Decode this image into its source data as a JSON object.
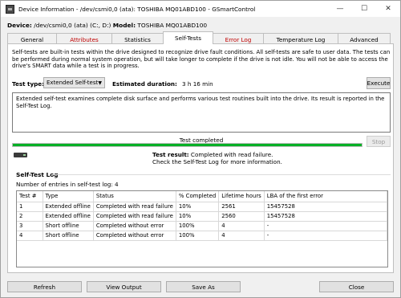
{
  "window": {
    "title": "Device Information - /dev/csmi0,0 (ata): TOSHIBA MQ01ABD100 - GSmartControl",
    "minimize": "—",
    "maximize": "☐",
    "close": "✕"
  },
  "device": {
    "label": "Device:",
    "path": " /dev/csmi0,0 (ata) (C:, D:) ",
    "model_label": "Model:",
    "model": " TOSHIBA MQ01ABD100"
  },
  "tabs": [
    {
      "label": "General",
      "state": "normal"
    },
    {
      "label": "Attributes",
      "state": "error"
    },
    {
      "label": "Statistics",
      "state": "normal"
    },
    {
      "label": "Self-Tests",
      "state": "active"
    },
    {
      "label": "Error Log",
      "state": "error"
    },
    {
      "label": "Temperature Log",
      "state": "normal"
    },
    {
      "label": "Advanced",
      "state": "normal"
    }
  ],
  "selftests": {
    "intro": "Self-tests are built-in tests within the drive designed to recognize drive fault conditions. All self-tests are safe to user data. The tests can be performed during normal system operation, but will take longer to complete if the drive is not idle. You will not be able to access the drive's SMART data while a test is in progress.",
    "test_type_label": "Test type:",
    "test_type_value": "Extended Self-test",
    "est_label": "Estimated duration:",
    "est_value": "3 h 16 min",
    "execute_label": "Execute",
    "description": "Extended self-test examines complete disk surface and performs various test routines built into the drive. Its result is reported in the Self-Test Log.",
    "status_text": "Test completed",
    "progress": 1.0,
    "stop_label": "Stop",
    "result_label": "Test result:",
    "result_value": " Completed with read failure.",
    "result_hint": "Check the Self-Test Log for more information."
  },
  "log": {
    "title": "Self-Test Log",
    "count_text": "Number of entries in self-test log: 4",
    "columns": [
      "Test #",
      "Type",
      "Status",
      "% Completed",
      "Lifetime hours",
      "LBA of the first error"
    ],
    "rows": [
      [
        "1",
        "Extended offline",
        "Completed with read failure",
        "10%",
        "2561",
        "15457528"
      ],
      [
        "2",
        "Extended offline",
        "Completed with read failure",
        "10%",
        "2560",
        "15457528"
      ],
      [
        "3",
        "Short offline",
        "Completed without error",
        "100%",
        "4",
        "-"
      ],
      [
        "4",
        "Short offline",
        "Completed without error",
        "100%",
        "4",
        "-"
      ]
    ]
  },
  "buttons": {
    "refresh": "Refresh",
    "view_output": "View Output",
    "save_as": "Save As",
    "close": "Close"
  },
  "colors": {
    "error_tab": "#c00000",
    "progress_fill": "#06b025"
  }
}
